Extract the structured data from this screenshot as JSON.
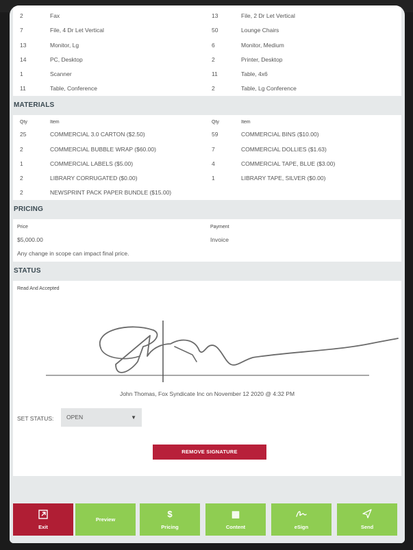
{
  "equipment": {
    "rows": [
      {
        "q1": "2",
        "i1": "Fax",
        "q2": "13",
        "i2": "File, 2 Dr Let Vertical"
      },
      {
        "q1": "7",
        "i1": "File, 4 Dr Let Vertical",
        "q2": "50",
        "i2": "Lounge Chairs"
      },
      {
        "q1": "13",
        "i1": "Monitor, Lg",
        "q2": "6",
        "i2": "Monitor, Medium"
      },
      {
        "q1": "14",
        "i1": "PC, Desktop",
        "q2": "2",
        "i2": "Printer, Desktop"
      },
      {
        "q1": "1",
        "i1": "Scanner",
        "q2": "11",
        "i2": "Table, 4x6"
      },
      {
        "q1": "11",
        "i1": "Table, Conference",
        "q2": "2",
        "i2": "Table, Lg Conference"
      }
    ]
  },
  "materials": {
    "title": "MATERIALS",
    "qty_header": "Qty",
    "item_header": "Item",
    "rows": [
      {
        "q1": "25",
        "i1": "COMMERCIAL 3.0 CARTON ($2.50)",
        "q2": "59",
        "i2": "COMMERCIAL BINS ($10.00)"
      },
      {
        "q1": "2",
        "i1": "COMMERCIAL BUBBLE WRAP ($60.00)",
        "q2": "7",
        "i2": "COMMERCIAL DOLLIES ($1.63)"
      },
      {
        "q1": "1",
        "i1": "COMMERCIAL LABELS ($5.00)",
        "q2": "4",
        "i2": "COMMERCIAL TAPE, BLUE ($3.00)"
      },
      {
        "q1": "2",
        "i1": "LIBRARY CORRUGATED ($0.00)",
        "q2": "1",
        "i2": "LIBRARY TAPE, SILVER ($0.00)"
      },
      {
        "q1": "2",
        "i1": "NEWSPRINT PACK PAPER BUNDLE ($15.00)",
        "q2": "",
        "i2": ""
      }
    ]
  },
  "pricing": {
    "title": "PRICING",
    "price_label": "Price",
    "price_value": "$5,000.00",
    "payment_label": "Payment",
    "payment_value": "Invoice",
    "note": "Any change in scope can impact final price."
  },
  "status": {
    "title": "STATUS",
    "read_label": "Read And Accepted",
    "signature_caption": "John Thomas, Fox Syndicate Inc on November 12 2020 @ 4:32 PM",
    "set_status_label": "SET STATUS:",
    "status_value": "OPEN",
    "remove_signature": "REMOVE SIGNATURE"
  },
  "footer": {
    "buttons": [
      {
        "label": "Exit",
        "icon": "exit-icon"
      },
      {
        "label": "Preview",
        "icon": ""
      },
      {
        "label": "Pricing",
        "icon": "dollar-icon"
      },
      {
        "label": "Content",
        "icon": "grid-icon"
      },
      {
        "label": "eSign",
        "icon": "signature-icon"
      },
      {
        "label": "Send",
        "icon": "send-icon"
      }
    ]
  },
  "colors": {
    "accent_red": "#b8203a",
    "accent_green": "#8fcd52",
    "section_bg": "#e6e9ea"
  }
}
